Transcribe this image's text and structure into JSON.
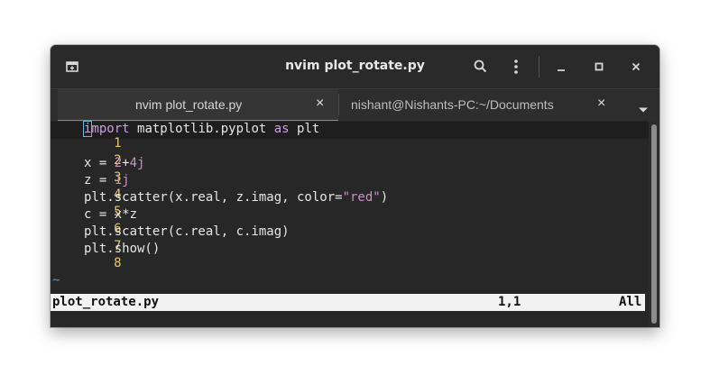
{
  "window": {
    "title": "nvim plot_rotate.py"
  },
  "tabs": [
    {
      "label": "nvim plot_rotate.py",
      "close": "×",
      "active": true
    },
    {
      "label": "nishant@Nishants-PC:~/Documents",
      "close": "×",
      "active": false
    }
  ],
  "editor": {
    "lines": [
      {
        "n": "1",
        "text": "import matplotlib.pyplot as plt"
      },
      {
        "n": "2",
        "text": ""
      },
      {
        "n": "3",
        "text": "x = 2+4j"
      },
      {
        "n": "4",
        "text": "z = 1j"
      },
      {
        "n": "5",
        "text": "plt.scatter(x.real, z.imag, color=\"red\")"
      },
      {
        "n": "6",
        "text": "c = x*z"
      },
      {
        "n": "7",
        "text": "plt.scatter(c.real, c.imag)"
      },
      {
        "n": "8",
        "text": "plt.show()"
      }
    ],
    "tilde": "~"
  },
  "statusline": {
    "filename": "plot_rotate.py",
    "position": "1,1",
    "scroll": "All"
  },
  "colors": {
    "line_number": "#e6c773",
    "keyword": "#c9a0dc",
    "literal": "#c792c4",
    "tab_accent": "#5b8fd6"
  },
  "icons": {
    "new_tab": "new-tab-icon",
    "search": "search-icon",
    "menu": "kebab-menu-icon",
    "minimize": "minimize-icon",
    "maximize": "maximize-icon",
    "close": "close-icon",
    "tab_dropdown": "chevron-down-icon"
  }
}
